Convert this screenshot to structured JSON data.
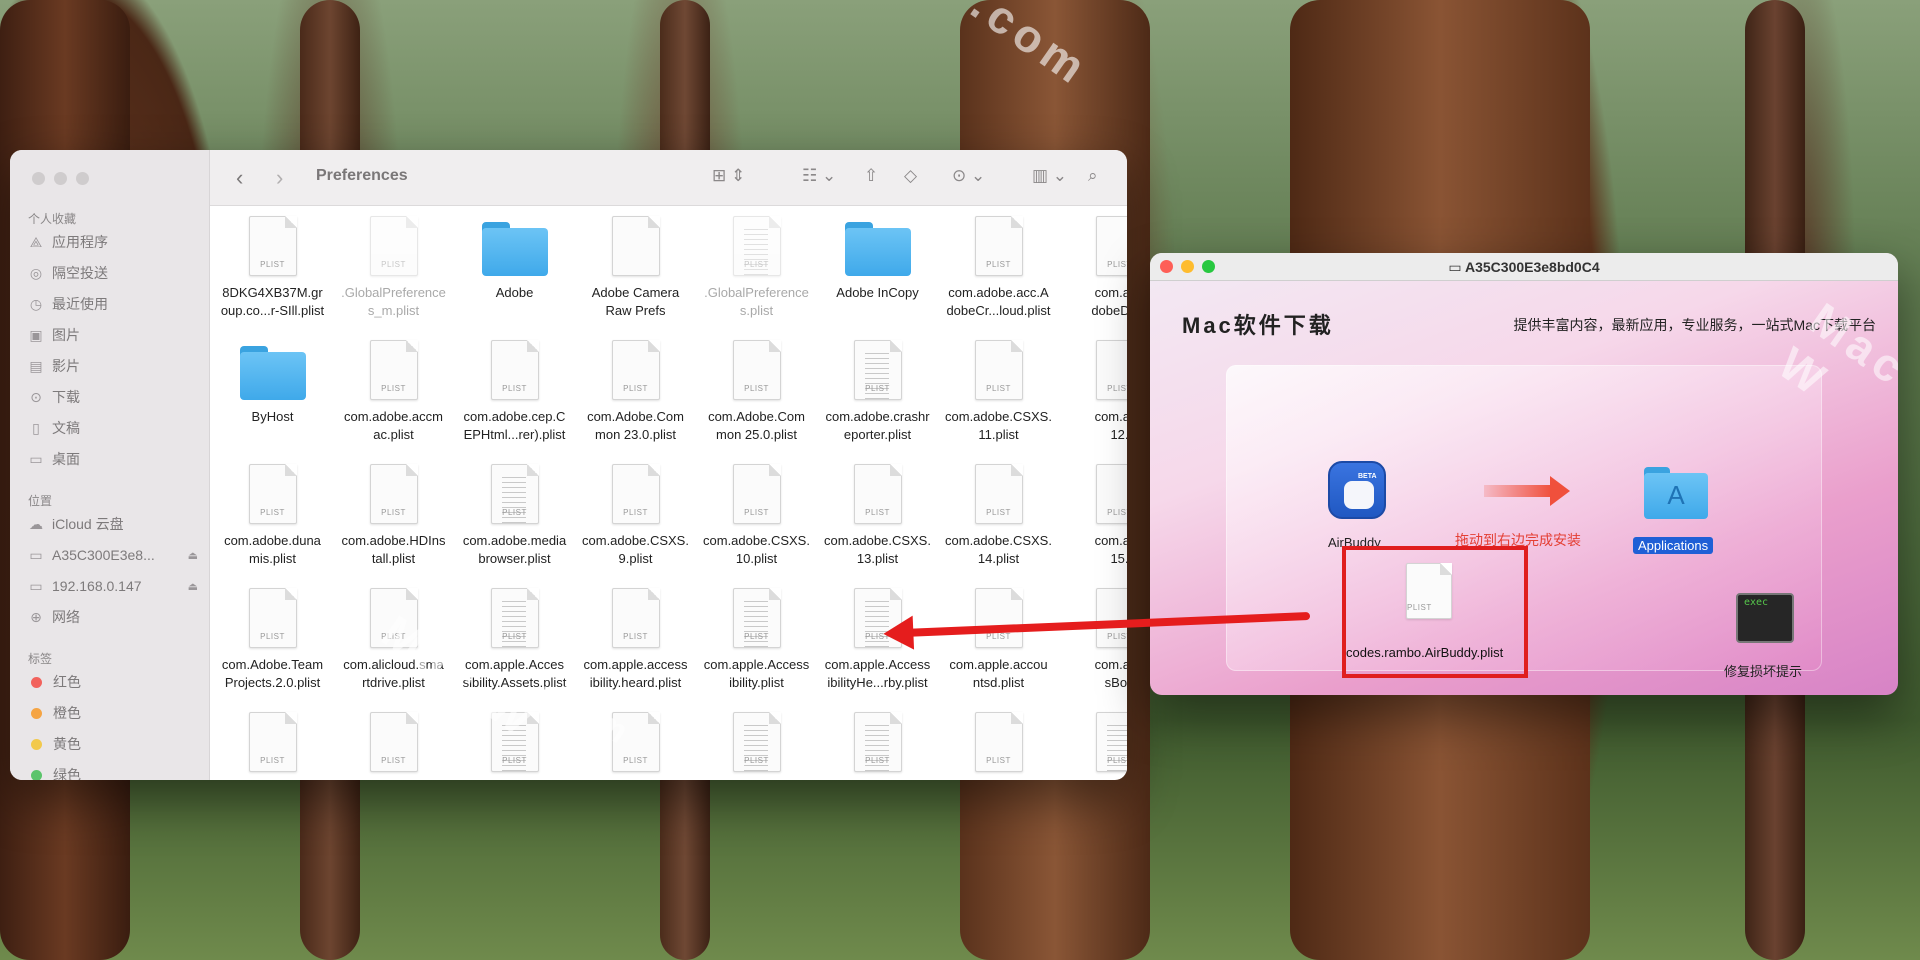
{
  "finder": {
    "title": "Preferences",
    "sidebar": {
      "favorites_heading": "个人收藏",
      "favorites": [
        {
          "label": "应用程序",
          "icon": "apps-icon"
        },
        {
          "label": "隔空投送",
          "icon": "airdrop-icon"
        },
        {
          "label": "最近使用",
          "icon": "clock-icon"
        },
        {
          "label": "图片",
          "icon": "photo-icon"
        },
        {
          "label": "影片",
          "icon": "film-icon"
        },
        {
          "label": "下载",
          "icon": "download-icon"
        },
        {
          "label": "文稿",
          "icon": "document-icon"
        },
        {
          "label": "桌面",
          "icon": "desktop-icon"
        }
      ],
      "locations_heading": "位置",
      "locations": [
        {
          "label": "iCloud 云盘",
          "icon": "cloud-icon"
        },
        {
          "label": "A35C300E3e8...",
          "icon": "disk-icon",
          "eject": true
        },
        {
          "label": "192.168.0.147",
          "icon": "display-icon",
          "eject": true
        },
        {
          "label": "网络",
          "icon": "network-icon"
        }
      ],
      "tags_heading": "标签",
      "tags": [
        {
          "label": "红色",
          "color": "#f2625c"
        },
        {
          "label": "橙色",
          "color": "#f5a443"
        },
        {
          "label": "黄色",
          "color": "#f2c94c"
        },
        {
          "label": "绿色",
          "color": "#5bc46b"
        }
      ]
    },
    "files": [
      [
        "8DKG4XB37M.gr",
        "oup.co...r-SIll.plist"
      ],
      [
        ".GlobalPreference",
        "s_m.plist"
      ],
      [
        "Adobe",
        ""
      ],
      [
        "Adobe Camera",
        "Raw Prefs"
      ],
      [
        ".GlobalPreference",
        "s.plist"
      ],
      [
        "Adobe InCopy",
        ""
      ],
      [
        "com.adobe.acc.A",
        "dobeCr...loud.plist"
      ],
      [
        "com.ado",
        "dobeDe..."
      ],
      [
        "ByHost",
        ""
      ],
      [
        "com.adobe.accm",
        "ac.plist"
      ],
      [
        "com.adobe.cep.C",
        "EPHtml...rer).plist"
      ],
      [
        "com.Adobe.Com",
        "mon 23.0.plist"
      ],
      [
        "com.Adobe.Com",
        "mon 25.0.plist"
      ],
      [
        "com.adobe.crashr",
        "eporter.plist"
      ],
      [
        "com.adobe.CSXS.",
        "11.plist"
      ],
      [
        "com.ado",
        "12."
      ],
      [
        "com.adobe.duna",
        "mis.plist"
      ],
      [
        "com.adobe.HDIns",
        "tall.plist"
      ],
      [
        "com.adobe.media",
        "browser.plist"
      ],
      [
        "com.adobe.CSXS.",
        "9.plist"
      ],
      [
        "com.adobe.CSXS.",
        "10.plist"
      ],
      [
        "com.adobe.CSXS.",
        "13.plist"
      ],
      [
        "com.adobe.CSXS.",
        "14.plist"
      ],
      [
        "com.ado",
        "15."
      ],
      [
        "com.Adobe.Team",
        "Projects.2.0.plist"
      ],
      [
        "com.alicloud.sma",
        "rtdrive.plist"
      ],
      [
        "com.apple.Acces",
        "sibility.Assets.plist"
      ],
      [
        "com.apple.access",
        "ibility.heard.plist"
      ],
      [
        "com.apple.Access",
        "ibility.plist"
      ],
      [
        "com.apple.Access",
        "ibilityHe...rby.plist"
      ],
      [
        "com.apple.accou",
        "ntsd.plist"
      ],
      [
        "com.app",
        "sBoo"
      ]
    ],
    "plist_badge": "PLIST"
  },
  "dmg": {
    "title": "A35C300E3e8bd0C4",
    "brand": "Mac软件下载",
    "tagline": "提供丰富内容，最新应用，专业服务，一站式Mac下载平台",
    "airbuddy_label": "AirBuddy",
    "beta_badge": "BETA",
    "drag_hint": "拖动到右边完成安装",
    "applications_label": "Applications",
    "plist_name": "codes.rambo.AirBuddy.plist",
    "exec_badge": "exec",
    "exec_label": "修复损坏提示"
  },
  "watermarks": {
    "top": ".com",
    "finder": "Mac W",
    "finder_com": ".com",
    "dmg": "Mac W"
  }
}
